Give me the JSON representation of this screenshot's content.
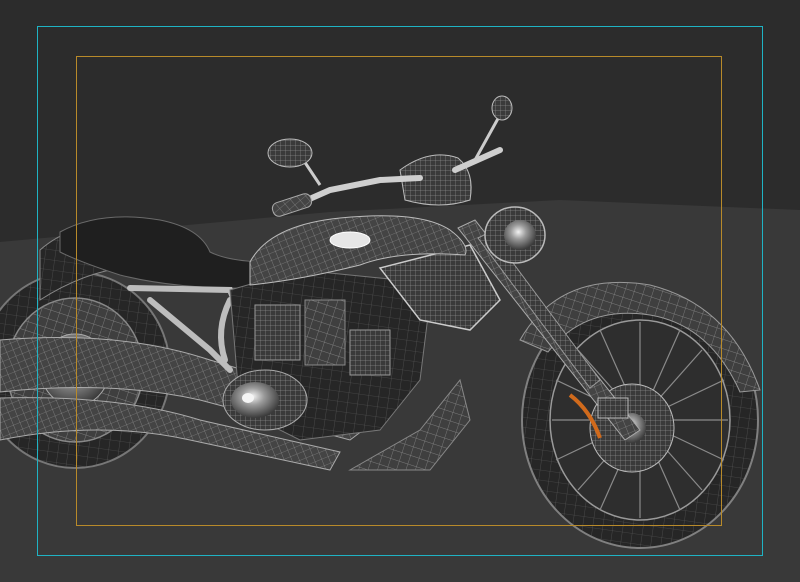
{
  "viewport": {
    "colors": {
      "background": "#2c2c2c",
      "ground": "#3a3a3a",
      "wire": "#9a9a9a",
      "body": "#3c3c3c",
      "accent": "#d06a1c",
      "outer_frame": "#1fb3c4",
      "inner_frame": "#b88a2a"
    }
  }
}
